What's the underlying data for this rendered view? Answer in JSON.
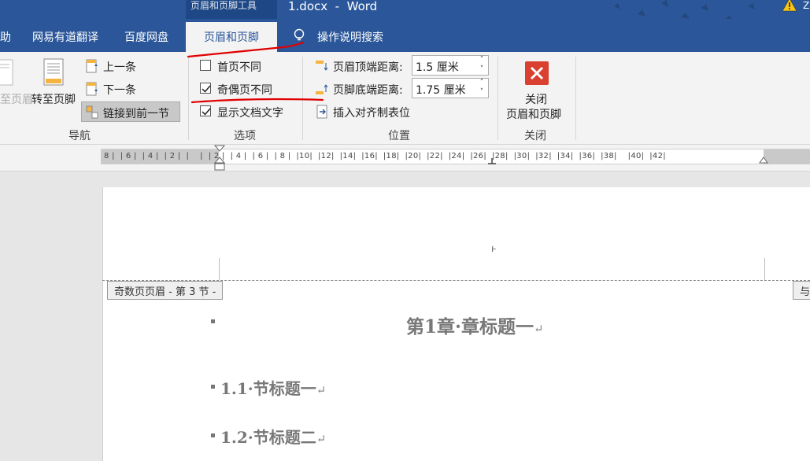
{
  "titlebar": {
    "context_tab_title": "页眉和页脚工具",
    "doc_title": "1.docx  -  Word",
    "account_mark": "Z"
  },
  "tabs": [
    {
      "label": "助"
    },
    {
      "label": "网易有道翻译"
    },
    {
      "label": "百度网盘"
    },
    {
      "label": "页眉和页脚"
    },
    {
      "label": "操作说明搜索"
    }
  ],
  "ribbon": {
    "navigation": {
      "goto_header": "至页眉",
      "goto_footer": "转至页脚",
      "previous": "上一条",
      "next": "下一条",
      "link_to_previous": "链接到前一节",
      "group_label": "导航"
    },
    "options": {
      "different_first_page": {
        "label": "首页不同",
        "checked": false
      },
      "different_odd_even": {
        "label": "奇偶页不同",
        "checked": true
      },
      "show_document_text": {
        "label": "显示文档文字",
        "checked": true
      },
      "group_label": "选项"
    },
    "position": {
      "header_from_top_label": "页眉顶端距离:",
      "header_from_top_value": "1.5 厘米",
      "footer_from_bottom_label": "页脚底端距离:",
      "footer_from_bottom_value": "1.75 厘米",
      "insert_alignment_tab": "插入对齐制表位",
      "group_label": "位置"
    },
    "close": {
      "line1": "关闭",
      "line2": "页眉和页脚",
      "group_label": "关闭"
    }
  },
  "ruler": {
    "text": "8 |  | 6 |  | 4 |  | 2 |  |    |  | 2 |  | 4 |  | 6 |  | 8 |  |10|  |12|  |14|  |16|  |18|  |20|  |22|  |24|  |26|  |28|  |30|  |32|  |34|  |36|  |38|    |40|  |42|"
  },
  "document": {
    "header_tag": "奇数页页眉 - 第 3 节 -",
    "same_as_prev_tag": "与",
    "chapter_title": "第1章·章标题一",
    "sections": [
      "1.1·节标题一",
      "1.2·节标题二"
    ],
    "return_mark": "↵",
    "cursor_mark": "ⱶ"
  },
  "colors": {
    "accent": "#2b579a",
    "annotation_red": "#e00000",
    "close_icon": "#d9402f"
  }
}
